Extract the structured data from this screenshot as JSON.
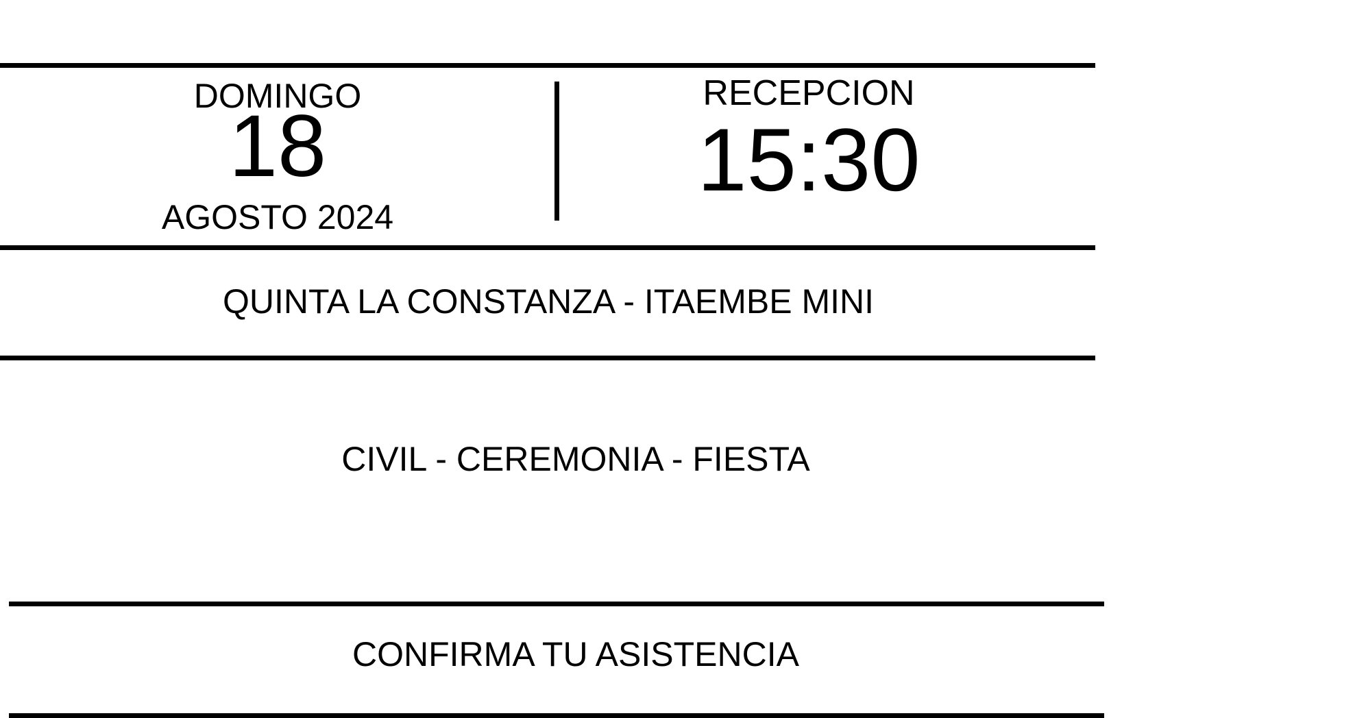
{
  "date": {
    "weekday": "DOMINGO",
    "day": "18",
    "month_year": "AGOSTO 2024"
  },
  "reception": {
    "label": "RECEPCION",
    "time": "15:30"
  },
  "venue": "QUINTA LA CONSTANZA - ITAEMBE MINI",
  "events": "CIVIL - CEREMONIA - FIESTA",
  "rsvp_label": "CONFIRMA TU ASISTENCIA"
}
